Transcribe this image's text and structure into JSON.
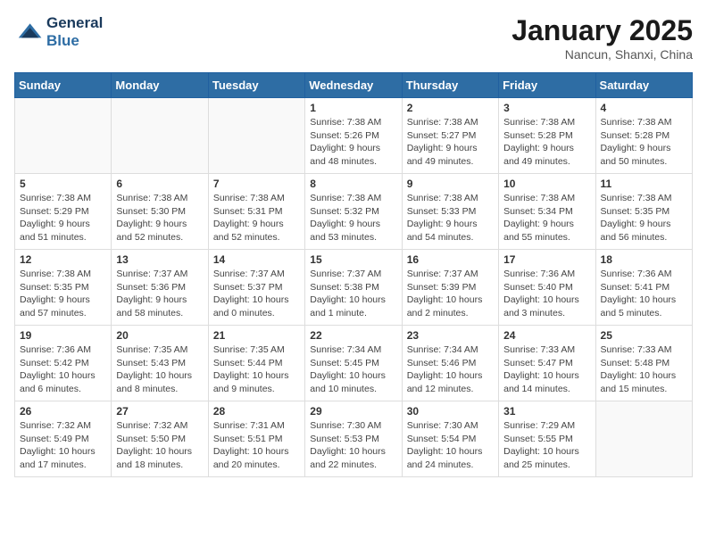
{
  "header": {
    "logo_line1": "General",
    "logo_line2": "Blue",
    "month": "January 2025",
    "location": "Nancun, Shanxi, China"
  },
  "weekdays": [
    "Sunday",
    "Monday",
    "Tuesday",
    "Wednesday",
    "Thursday",
    "Friday",
    "Saturday"
  ],
  "weeks": [
    [
      {
        "day": "",
        "info": ""
      },
      {
        "day": "",
        "info": ""
      },
      {
        "day": "",
        "info": ""
      },
      {
        "day": "1",
        "info": "Sunrise: 7:38 AM\nSunset: 5:26 PM\nDaylight: 9 hours\nand 48 minutes."
      },
      {
        "day": "2",
        "info": "Sunrise: 7:38 AM\nSunset: 5:27 PM\nDaylight: 9 hours\nand 49 minutes."
      },
      {
        "day": "3",
        "info": "Sunrise: 7:38 AM\nSunset: 5:28 PM\nDaylight: 9 hours\nand 49 minutes."
      },
      {
        "day": "4",
        "info": "Sunrise: 7:38 AM\nSunset: 5:28 PM\nDaylight: 9 hours\nand 50 minutes."
      }
    ],
    [
      {
        "day": "5",
        "info": "Sunrise: 7:38 AM\nSunset: 5:29 PM\nDaylight: 9 hours\nand 51 minutes."
      },
      {
        "day": "6",
        "info": "Sunrise: 7:38 AM\nSunset: 5:30 PM\nDaylight: 9 hours\nand 52 minutes."
      },
      {
        "day": "7",
        "info": "Sunrise: 7:38 AM\nSunset: 5:31 PM\nDaylight: 9 hours\nand 52 minutes."
      },
      {
        "day": "8",
        "info": "Sunrise: 7:38 AM\nSunset: 5:32 PM\nDaylight: 9 hours\nand 53 minutes."
      },
      {
        "day": "9",
        "info": "Sunrise: 7:38 AM\nSunset: 5:33 PM\nDaylight: 9 hours\nand 54 minutes."
      },
      {
        "day": "10",
        "info": "Sunrise: 7:38 AM\nSunset: 5:34 PM\nDaylight: 9 hours\nand 55 minutes."
      },
      {
        "day": "11",
        "info": "Sunrise: 7:38 AM\nSunset: 5:35 PM\nDaylight: 9 hours\nand 56 minutes."
      }
    ],
    [
      {
        "day": "12",
        "info": "Sunrise: 7:38 AM\nSunset: 5:35 PM\nDaylight: 9 hours\nand 57 minutes."
      },
      {
        "day": "13",
        "info": "Sunrise: 7:37 AM\nSunset: 5:36 PM\nDaylight: 9 hours\nand 58 minutes."
      },
      {
        "day": "14",
        "info": "Sunrise: 7:37 AM\nSunset: 5:37 PM\nDaylight: 10 hours\nand 0 minutes."
      },
      {
        "day": "15",
        "info": "Sunrise: 7:37 AM\nSunset: 5:38 PM\nDaylight: 10 hours\nand 1 minute."
      },
      {
        "day": "16",
        "info": "Sunrise: 7:37 AM\nSunset: 5:39 PM\nDaylight: 10 hours\nand 2 minutes."
      },
      {
        "day": "17",
        "info": "Sunrise: 7:36 AM\nSunset: 5:40 PM\nDaylight: 10 hours\nand 3 minutes."
      },
      {
        "day": "18",
        "info": "Sunrise: 7:36 AM\nSunset: 5:41 PM\nDaylight: 10 hours\nand 5 minutes."
      }
    ],
    [
      {
        "day": "19",
        "info": "Sunrise: 7:36 AM\nSunset: 5:42 PM\nDaylight: 10 hours\nand 6 minutes."
      },
      {
        "day": "20",
        "info": "Sunrise: 7:35 AM\nSunset: 5:43 PM\nDaylight: 10 hours\nand 8 minutes."
      },
      {
        "day": "21",
        "info": "Sunrise: 7:35 AM\nSunset: 5:44 PM\nDaylight: 10 hours\nand 9 minutes."
      },
      {
        "day": "22",
        "info": "Sunrise: 7:34 AM\nSunset: 5:45 PM\nDaylight: 10 hours\nand 10 minutes."
      },
      {
        "day": "23",
        "info": "Sunrise: 7:34 AM\nSunset: 5:46 PM\nDaylight: 10 hours\nand 12 minutes."
      },
      {
        "day": "24",
        "info": "Sunrise: 7:33 AM\nSunset: 5:47 PM\nDaylight: 10 hours\nand 14 minutes."
      },
      {
        "day": "25",
        "info": "Sunrise: 7:33 AM\nSunset: 5:48 PM\nDaylight: 10 hours\nand 15 minutes."
      }
    ],
    [
      {
        "day": "26",
        "info": "Sunrise: 7:32 AM\nSunset: 5:49 PM\nDaylight: 10 hours\nand 17 minutes."
      },
      {
        "day": "27",
        "info": "Sunrise: 7:32 AM\nSunset: 5:50 PM\nDaylight: 10 hours\nand 18 minutes."
      },
      {
        "day": "28",
        "info": "Sunrise: 7:31 AM\nSunset: 5:51 PM\nDaylight: 10 hours\nand 20 minutes."
      },
      {
        "day": "29",
        "info": "Sunrise: 7:30 AM\nSunset: 5:53 PM\nDaylight: 10 hours\nand 22 minutes."
      },
      {
        "day": "30",
        "info": "Sunrise: 7:30 AM\nSunset: 5:54 PM\nDaylight: 10 hours\nand 24 minutes."
      },
      {
        "day": "31",
        "info": "Sunrise: 7:29 AM\nSunset: 5:55 PM\nDaylight: 10 hours\nand 25 minutes."
      },
      {
        "day": "",
        "info": ""
      }
    ]
  ]
}
